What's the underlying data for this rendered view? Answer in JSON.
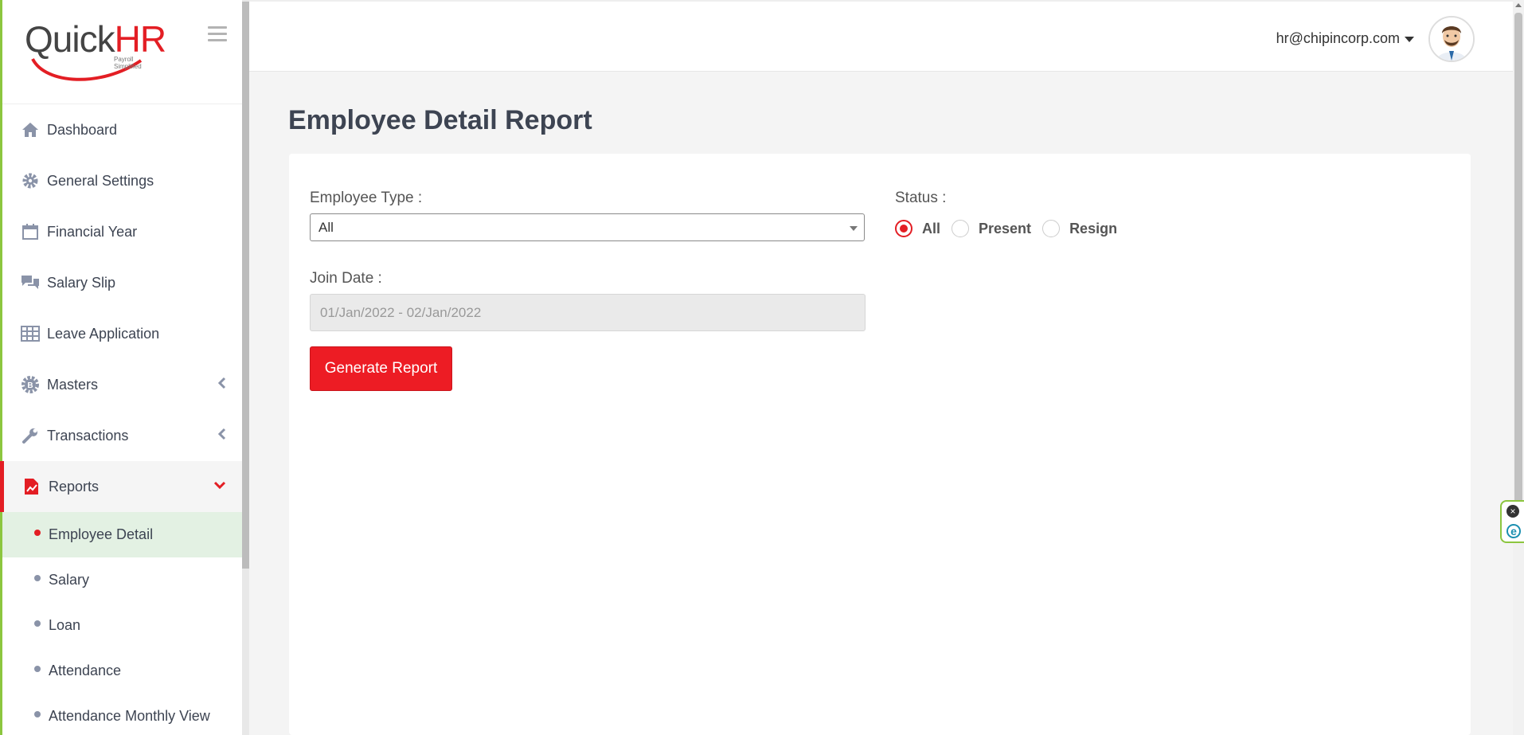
{
  "app": {
    "logo_text_a": "Quick",
    "logo_text_b": "HR",
    "logo_tagline": "Payroll Simplified"
  },
  "sidebar": {
    "items": [
      {
        "label": "Dashboard",
        "icon": "home-icon"
      },
      {
        "label": "General Settings",
        "icon": "gear-icon"
      },
      {
        "label": "Financial Year",
        "icon": "calendar-icon"
      },
      {
        "label": "Salary Slip",
        "icon": "chat-icon"
      },
      {
        "label": "Leave Application",
        "icon": "table-icon"
      },
      {
        "label": "Masters",
        "icon": "settings-badge-icon"
      },
      {
        "label": "Transactions",
        "icon": "wrench-icon"
      },
      {
        "label": "Reports",
        "icon": "report-icon"
      }
    ],
    "report_sub": [
      "Employee Detail",
      "Salary",
      "Loan",
      "Attendance",
      "Attendance Monthly View"
    ]
  },
  "header": {
    "user_email": "hr@chipincorp.com"
  },
  "main": {
    "title": "Employee Detail Report",
    "employee_type_label": "Employee Type :",
    "employee_type_value": "All",
    "status_label": "Status :",
    "status_options": [
      "All",
      "Present",
      "Resign"
    ],
    "status_selected": "All",
    "join_date_label": "Join Date :",
    "join_date_value": "01/Jan/2022 - 02/Jan/2022",
    "generate_button": "Generate Report"
  },
  "colors": {
    "accent": "#e31e24",
    "brand_green": "#8cc63f",
    "text": "#3d4452"
  }
}
